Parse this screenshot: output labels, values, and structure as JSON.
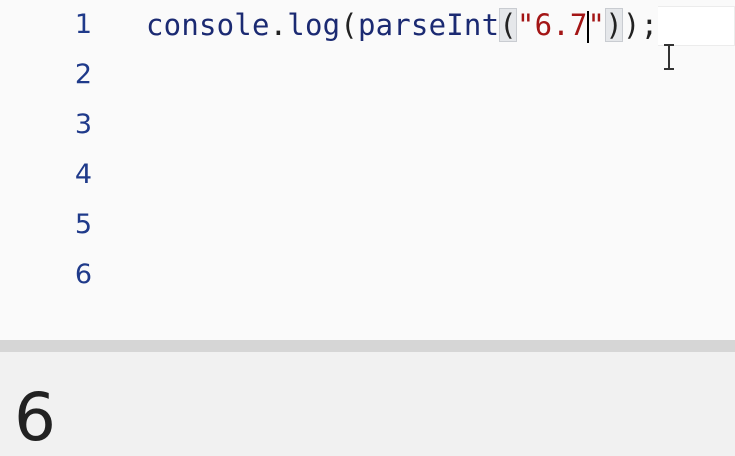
{
  "editor": {
    "line_numbers": [
      "1",
      "2",
      "3",
      "4",
      "5",
      "6"
    ],
    "code": {
      "object": "console",
      "dot": ".",
      "method": "log",
      "open_paren_1": "(",
      "function": "parseInt",
      "open_paren_2": "(",
      "string_before_caret": "\"6.7",
      "string_after_caret": "\"",
      "close_paren_2": ")",
      "close_paren_1": ")",
      "semicolon": ";"
    }
  },
  "console": {
    "output": "6"
  },
  "colors": {
    "identifier": "#1b2a72",
    "string": "#a31515",
    "line_number": "#1f3a8a"
  }
}
